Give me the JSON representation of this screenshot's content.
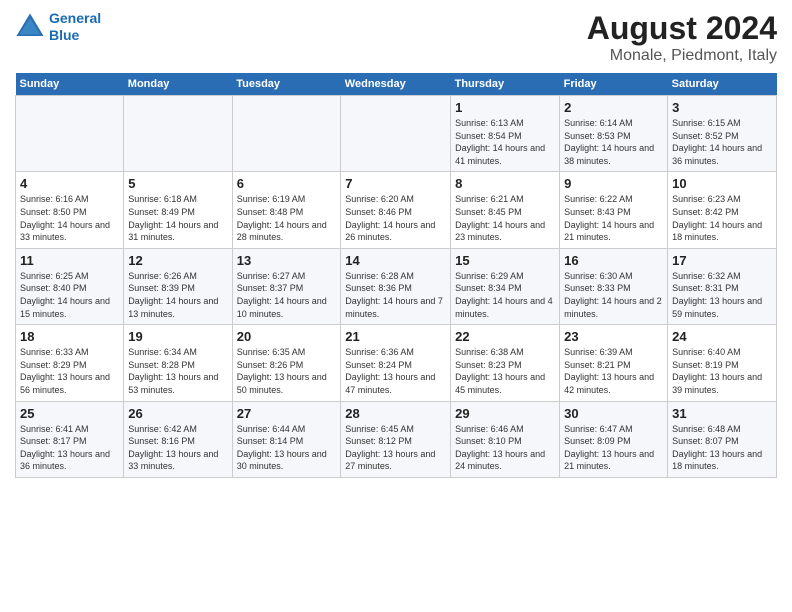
{
  "header": {
    "logo_line1": "General",
    "logo_line2": "Blue",
    "title": "August 2024",
    "subtitle": "Monale, Piedmont, Italy"
  },
  "days_of_week": [
    "Sunday",
    "Monday",
    "Tuesday",
    "Wednesday",
    "Thursday",
    "Friday",
    "Saturday"
  ],
  "weeks": [
    [
      {
        "day": "",
        "detail": ""
      },
      {
        "day": "",
        "detail": ""
      },
      {
        "day": "",
        "detail": ""
      },
      {
        "day": "",
        "detail": ""
      },
      {
        "day": "1",
        "detail": "Sunrise: 6:13 AM\nSunset: 8:54 PM\nDaylight: 14 hours and 41 minutes."
      },
      {
        "day": "2",
        "detail": "Sunrise: 6:14 AM\nSunset: 8:53 PM\nDaylight: 14 hours and 38 minutes."
      },
      {
        "day": "3",
        "detail": "Sunrise: 6:15 AM\nSunset: 8:52 PM\nDaylight: 14 hours and 36 minutes."
      }
    ],
    [
      {
        "day": "4",
        "detail": "Sunrise: 6:16 AM\nSunset: 8:50 PM\nDaylight: 14 hours and 33 minutes."
      },
      {
        "day": "5",
        "detail": "Sunrise: 6:18 AM\nSunset: 8:49 PM\nDaylight: 14 hours and 31 minutes."
      },
      {
        "day": "6",
        "detail": "Sunrise: 6:19 AM\nSunset: 8:48 PM\nDaylight: 14 hours and 28 minutes."
      },
      {
        "day": "7",
        "detail": "Sunrise: 6:20 AM\nSunset: 8:46 PM\nDaylight: 14 hours and 26 minutes."
      },
      {
        "day": "8",
        "detail": "Sunrise: 6:21 AM\nSunset: 8:45 PM\nDaylight: 14 hours and 23 minutes."
      },
      {
        "day": "9",
        "detail": "Sunrise: 6:22 AM\nSunset: 8:43 PM\nDaylight: 14 hours and 21 minutes."
      },
      {
        "day": "10",
        "detail": "Sunrise: 6:23 AM\nSunset: 8:42 PM\nDaylight: 14 hours and 18 minutes."
      }
    ],
    [
      {
        "day": "11",
        "detail": "Sunrise: 6:25 AM\nSunset: 8:40 PM\nDaylight: 14 hours and 15 minutes."
      },
      {
        "day": "12",
        "detail": "Sunrise: 6:26 AM\nSunset: 8:39 PM\nDaylight: 14 hours and 13 minutes."
      },
      {
        "day": "13",
        "detail": "Sunrise: 6:27 AM\nSunset: 8:37 PM\nDaylight: 14 hours and 10 minutes."
      },
      {
        "day": "14",
        "detail": "Sunrise: 6:28 AM\nSunset: 8:36 PM\nDaylight: 14 hours and 7 minutes."
      },
      {
        "day": "15",
        "detail": "Sunrise: 6:29 AM\nSunset: 8:34 PM\nDaylight: 14 hours and 4 minutes."
      },
      {
        "day": "16",
        "detail": "Sunrise: 6:30 AM\nSunset: 8:33 PM\nDaylight: 14 hours and 2 minutes."
      },
      {
        "day": "17",
        "detail": "Sunrise: 6:32 AM\nSunset: 8:31 PM\nDaylight: 13 hours and 59 minutes."
      }
    ],
    [
      {
        "day": "18",
        "detail": "Sunrise: 6:33 AM\nSunset: 8:29 PM\nDaylight: 13 hours and 56 minutes."
      },
      {
        "day": "19",
        "detail": "Sunrise: 6:34 AM\nSunset: 8:28 PM\nDaylight: 13 hours and 53 minutes."
      },
      {
        "day": "20",
        "detail": "Sunrise: 6:35 AM\nSunset: 8:26 PM\nDaylight: 13 hours and 50 minutes."
      },
      {
        "day": "21",
        "detail": "Sunrise: 6:36 AM\nSunset: 8:24 PM\nDaylight: 13 hours and 47 minutes."
      },
      {
        "day": "22",
        "detail": "Sunrise: 6:38 AM\nSunset: 8:23 PM\nDaylight: 13 hours and 45 minutes."
      },
      {
        "day": "23",
        "detail": "Sunrise: 6:39 AM\nSunset: 8:21 PM\nDaylight: 13 hours and 42 minutes."
      },
      {
        "day": "24",
        "detail": "Sunrise: 6:40 AM\nSunset: 8:19 PM\nDaylight: 13 hours and 39 minutes."
      }
    ],
    [
      {
        "day": "25",
        "detail": "Sunrise: 6:41 AM\nSunset: 8:17 PM\nDaylight: 13 hours and 36 minutes."
      },
      {
        "day": "26",
        "detail": "Sunrise: 6:42 AM\nSunset: 8:16 PM\nDaylight: 13 hours and 33 minutes."
      },
      {
        "day": "27",
        "detail": "Sunrise: 6:44 AM\nSunset: 8:14 PM\nDaylight: 13 hours and 30 minutes."
      },
      {
        "day": "28",
        "detail": "Sunrise: 6:45 AM\nSunset: 8:12 PM\nDaylight: 13 hours and 27 minutes."
      },
      {
        "day": "29",
        "detail": "Sunrise: 6:46 AM\nSunset: 8:10 PM\nDaylight: 13 hours and 24 minutes."
      },
      {
        "day": "30",
        "detail": "Sunrise: 6:47 AM\nSunset: 8:09 PM\nDaylight: 13 hours and 21 minutes."
      },
      {
        "day": "31",
        "detail": "Sunrise: 6:48 AM\nSunset: 8:07 PM\nDaylight: 13 hours and 18 minutes."
      }
    ]
  ]
}
